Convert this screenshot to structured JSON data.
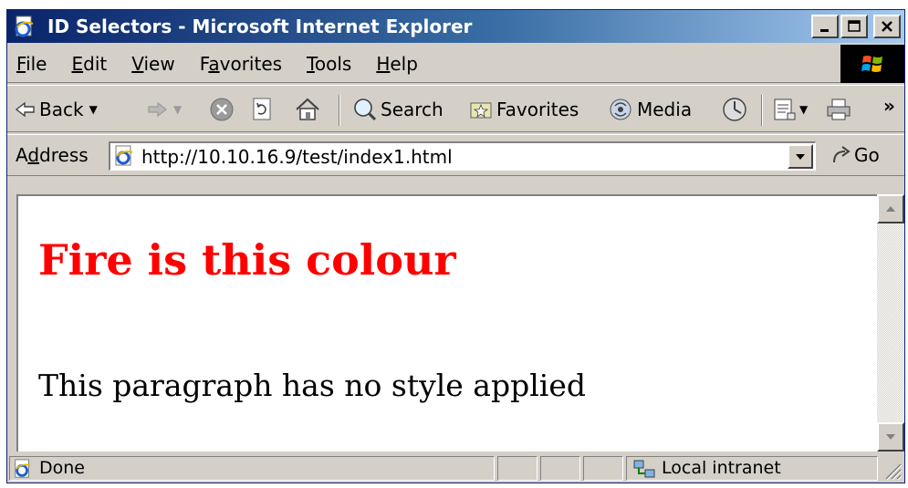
{
  "window": {
    "title": "ID Selectors - Microsoft Internet Explorer"
  },
  "menubar": {
    "items": [
      {
        "underline": "F",
        "rest": "ile"
      },
      {
        "underline": "E",
        "rest": "dit"
      },
      {
        "underline": "V",
        "rest": "iew"
      },
      {
        "pre": "F",
        "underline": "a",
        "rest": "vorites"
      },
      {
        "underline": "T",
        "rest": "ools"
      },
      {
        "underline": "H",
        "rest": "elp"
      }
    ]
  },
  "toolbar": {
    "back_label": "Back",
    "search_label": "Search",
    "favorites_label": "Favorites",
    "media_label": "Media",
    "overflow_label": "»"
  },
  "addressbar": {
    "label_pre": "A",
    "label_underline": "d",
    "label_rest": "dress",
    "url": "http://10.10.16.9/test/index1.html",
    "go_label": "Go"
  },
  "page": {
    "heading": "Fire is this colour",
    "heading_color": "#ff0000",
    "paragraph": "This paragraph has no style applied"
  },
  "statusbar": {
    "status": "Done",
    "zone": "Local intranet"
  },
  "colors": {
    "title_gradient_start": "#0a246a",
    "title_gradient_end": "#a6caf0",
    "chrome": "#d4d0c8"
  }
}
